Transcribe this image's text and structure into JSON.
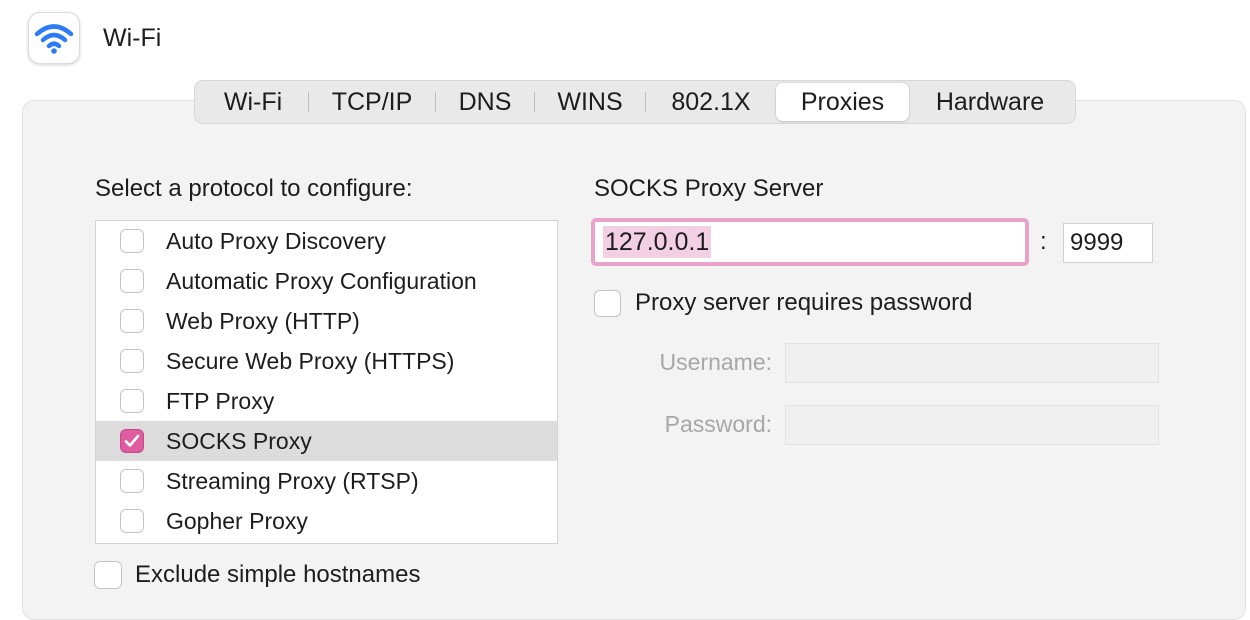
{
  "header": {
    "title": "Wi-Fi",
    "icon": "wifi-icon",
    "icon_color": "#2b7cf6"
  },
  "tabs": [
    {
      "label": "Wi-Fi",
      "active": false
    },
    {
      "label": "TCP/IP",
      "active": false
    },
    {
      "label": "DNS",
      "active": false
    },
    {
      "label": "WINS",
      "active": false
    },
    {
      "label": "802.1X",
      "active": false
    },
    {
      "label": "Proxies",
      "active": true
    },
    {
      "label": "Hardware",
      "active": false
    }
  ],
  "protocols": {
    "heading": "Select a protocol to configure:",
    "items": [
      {
        "label": "Auto Proxy Discovery",
        "checked": false
      },
      {
        "label": "Automatic Proxy Configuration",
        "checked": false
      },
      {
        "label": "Web Proxy (HTTP)",
        "checked": false
      },
      {
        "label": "Secure Web Proxy (HTTPS)",
        "checked": false
      },
      {
        "label": "FTP Proxy",
        "checked": false
      },
      {
        "label": "SOCKS Proxy",
        "checked": true,
        "selected": true
      },
      {
        "label": "Streaming Proxy (RTSP)",
        "checked": false
      },
      {
        "label": "Gopher Proxy",
        "checked": false
      }
    ]
  },
  "server": {
    "heading": "SOCKS Proxy Server",
    "address": "127.0.0.1",
    "separator": ":",
    "port": "9999",
    "requires_password_label": "Proxy server requires password",
    "requires_password": false,
    "username_label": "Username:",
    "username": "",
    "password_label": "Password:",
    "password": ""
  },
  "exclude_simple_hostnames": {
    "label": "Exclude simple hostnames",
    "checked": false
  },
  "colors": {
    "accent": "#e05ca0",
    "focus_ring": "#e9a3c9",
    "selection": "#f3cfe3"
  }
}
